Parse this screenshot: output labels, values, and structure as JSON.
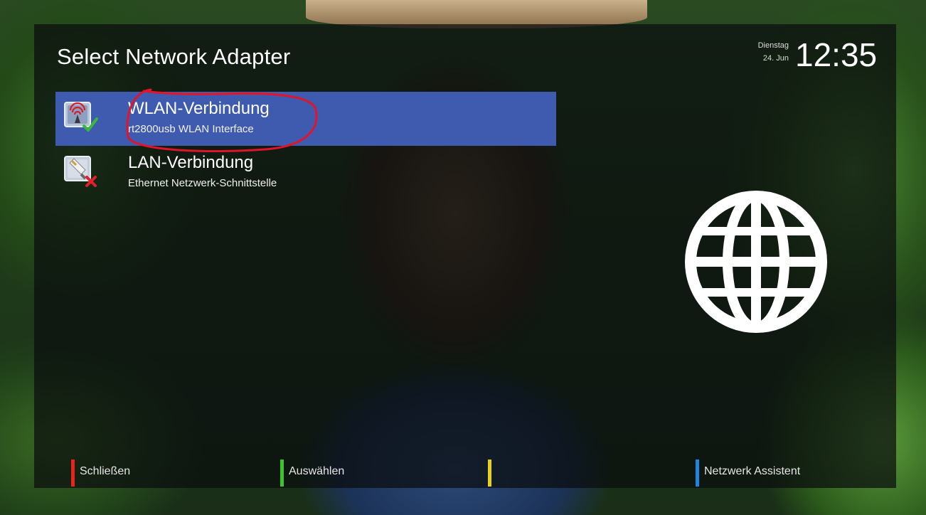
{
  "screen": {
    "title": "Select Network Adapter"
  },
  "clock": {
    "weekday": "Dienstag",
    "date": "24. Jun",
    "time": "12:35"
  },
  "adapters": [
    {
      "name": "WLAN-Verbindung",
      "description": "rt2800usb WLAN Interface",
      "icon": "wifi-antenna-icon",
      "status": "active",
      "selected": true
    },
    {
      "name": "LAN-Verbindung",
      "description": "Ethernet Netzwerk-Schnittstelle",
      "icon": "ethernet-plug-icon",
      "status": "inactive",
      "selected": false
    }
  ],
  "footer": {
    "red_label": "Schließen",
    "green_label": "Auswählen",
    "yellow_label": "",
    "blue_label": "Netzwerk Assistent"
  },
  "colors": {
    "selection": "#3f5bb0",
    "red": "#e8241d",
    "green": "#3cc42c",
    "yellow": "#e7d219",
    "blue": "#1e86e0",
    "annotation": "#e0142a"
  }
}
